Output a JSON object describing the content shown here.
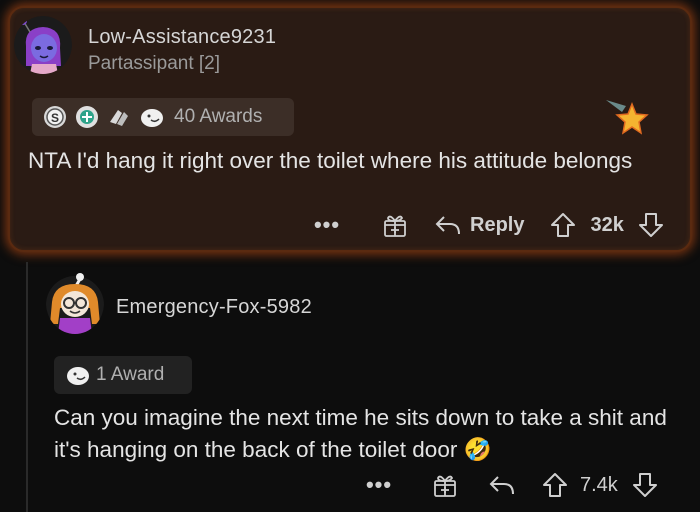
{
  "comments": [
    {
      "username": "Low-Assistance9231",
      "flair": "Partassipant [2]",
      "awards_label": "40 Awards",
      "body": "NTA I'd hang it right over the toilet where his attitude belongs",
      "reply_label": "Reply",
      "score": "32k"
    },
    {
      "username": "Emergency-Fox-5982",
      "awards_label": "1 Award",
      "body": "Can you imagine the next time he sits down to take a shit and it's hanging on the back of the toilet door 🤣",
      "score": "7.4k"
    }
  ],
  "icons": {
    "more": "ellipsis-icon",
    "gift": "gift-icon",
    "reply": "reply-arrow-icon",
    "upvote": "upvote-arrow-icon",
    "downvote": "downvote-arrow-icon"
  },
  "colors": {
    "highlight_border": "#c8501a",
    "highlight_bg": "#2a1b14",
    "background": "#0d0d0d"
  }
}
